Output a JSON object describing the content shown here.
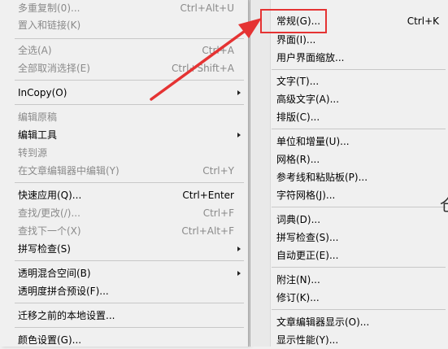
{
  "main_menu": {
    "items": [
      {
        "label": "多重复制(0)...",
        "shortcut": "Ctrl+Alt+U",
        "disabled": true,
        "submenu": false
      },
      {
        "label": "置入和链接(K)",
        "shortcut": "",
        "disabled": true,
        "submenu": false
      },
      {
        "label": "全选(A)",
        "shortcut": "Ctrl+A",
        "disabled": true,
        "submenu": false
      },
      {
        "label": "全部取消选择(E)",
        "shortcut": "Ctrl+Shift+A",
        "disabled": true,
        "submenu": false
      },
      {
        "label": "InCopy(O)",
        "shortcut": "",
        "disabled": false,
        "submenu": true
      },
      {
        "label": "编辑原稿",
        "shortcut": "",
        "disabled": true,
        "submenu": false
      },
      {
        "label": "编辑工具",
        "shortcut": "",
        "disabled": false,
        "submenu": true
      },
      {
        "label": "转到源",
        "shortcut": "",
        "disabled": true,
        "submenu": false
      },
      {
        "label": "在文章编辑器中编辑(Y)",
        "shortcut": "Ctrl+Y",
        "disabled": true,
        "submenu": false
      },
      {
        "label": "快速应用(Q)...",
        "shortcut": "Ctrl+Enter",
        "disabled": false,
        "submenu": false
      },
      {
        "label": "查找/更改(/)...",
        "shortcut": "Ctrl+F",
        "disabled": true,
        "submenu": false
      },
      {
        "label": "查找下一个(X)",
        "shortcut": "Ctrl+Alt+F",
        "disabled": true,
        "submenu": false
      },
      {
        "label": "拼写检查(S)",
        "shortcut": "",
        "disabled": false,
        "submenu": true
      },
      {
        "label": "透明混合空间(B)",
        "shortcut": "",
        "disabled": false,
        "submenu": true
      },
      {
        "label": "透明度拼合预设(F)...",
        "shortcut": "",
        "disabled": false,
        "submenu": false
      },
      {
        "label": "迁移之前的本地设置...",
        "shortcut": "",
        "disabled": false,
        "submenu": false
      },
      {
        "label": "颜色设置(G)...",
        "shortcut": "",
        "disabled": false,
        "submenu": false
      }
    ]
  },
  "sub_menu": {
    "items": [
      {
        "label": "常规(G)...",
        "shortcut": "Ctrl+K"
      },
      {
        "label": "界面(I)...",
        "shortcut": ""
      },
      {
        "label": "用户界面缩放...",
        "shortcut": ""
      },
      {
        "label": "文字(T)...",
        "shortcut": ""
      },
      {
        "label": "高级文字(A)...",
        "shortcut": ""
      },
      {
        "label": "排版(C)...",
        "shortcut": ""
      },
      {
        "label": "单位和增量(U)...",
        "shortcut": ""
      },
      {
        "label": "网格(R)...",
        "shortcut": ""
      },
      {
        "label": "参考线和粘贴板(P)...",
        "shortcut": ""
      },
      {
        "label": "字符网格(J)...",
        "shortcut": ""
      },
      {
        "label": "词典(D)...",
        "shortcut": ""
      },
      {
        "label": "拼写检查(S)...",
        "shortcut": ""
      },
      {
        "label": "自动更正(E)...",
        "shortcut": ""
      },
      {
        "label": "附注(N)...",
        "shortcut": ""
      },
      {
        "label": "修订(K)...",
        "shortcut": ""
      },
      {
        "label": "文章编辑器显示(O)...",
        "shortcut": ""
      },
      {
        "label": "显示性能(Y)...",
        "shortcut": ""
      }
    ]
  },
  "annotation": {
    "color": "#e53333"
  },
  "edge_glyph": "仓"
}
